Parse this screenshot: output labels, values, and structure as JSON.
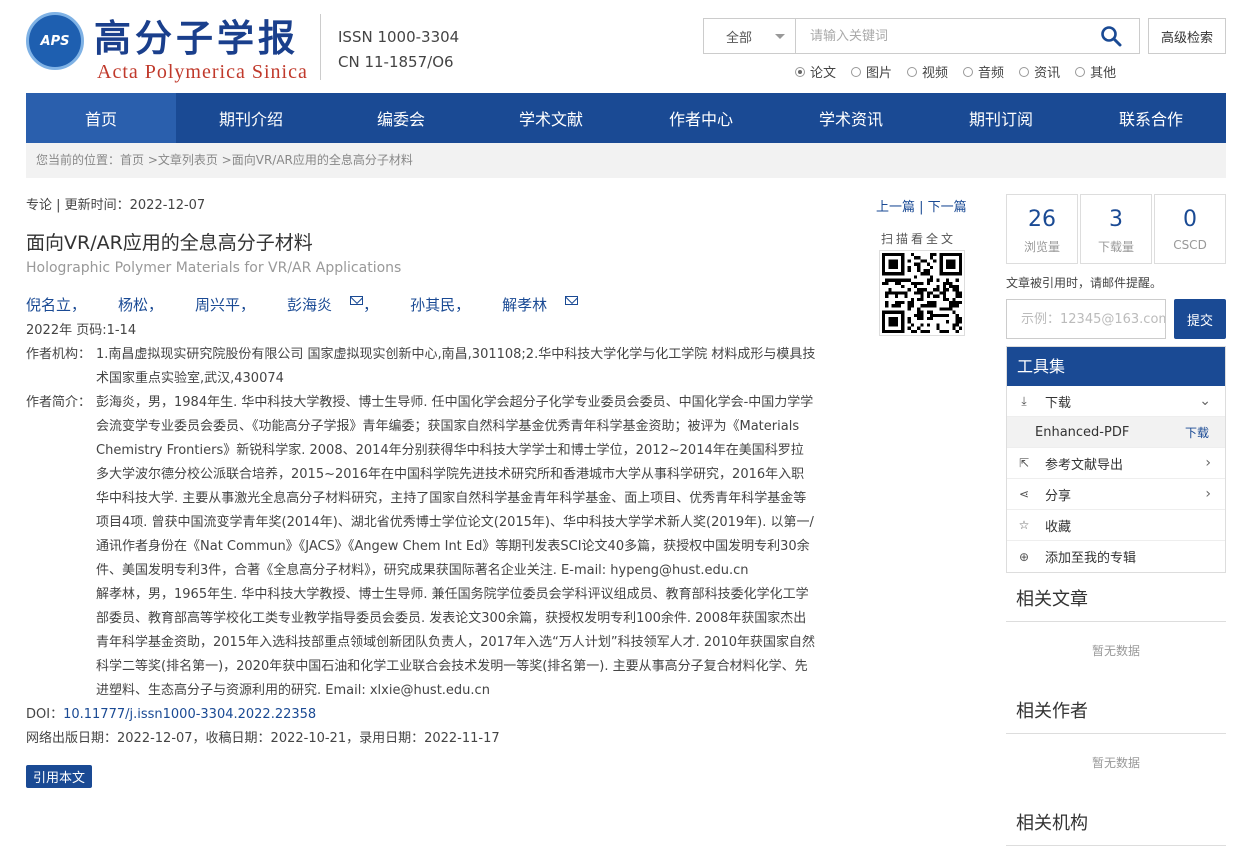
{
  "header": {
    "logo_text": "APS",
    "title_cn": "高分子学报",
    "title_en": "Acta Polymerica Sinica",
    "issn": "ISSN  1000-3304",
    "cn": "CN  11-1857/O6",
    "search_scope": "全部",
    "search_placeholder": "请输入关键词",
    "advanced_search": "高级检索",
    "search_types": [
      "论文",
      "图片",
      "视频",
      "音频",
      "资讯",
      "其他"
    ]
  },
  "nav": [
    "首页",
    "期刊介绍",
    "编委会",
    "学术文献",
    "作者中心",
    "学术资讯",
    "期刊订阅",
    "联系合作"
  ],
  "breadcrumb": "您当前的位置：首页 >文章列表页 >面向VR/AR应用的全息高分子材料",
  "article": {
    "meta": "专论 | 更新时间：2022-12-07",
    "title": "面向VR/AR应用的全息高分子材料",
    "title_en": "Holographic Polymer Materials for VR/AR Applications",
    "authors": [
      "倪名立，",
      "杨松，",
      "周兴平，",
      "彭海炎",
      "，",
      "孙其民，",
      "解孝林"
    ],
    "year_pages": "2022年 页码:1-14",
    "affiliation_label": "作者机构：",
    "affiliation": "1.南昌虚拟现实研究院股份有限公司 国家虚拟现实创新中心,南昌,301108;2.华中科技大学化学与化工学院 材料成形与模具技术国家重点实验室,武汉,430074",
    "bio_label": "作者简介：",
    "bio1": "彭海炎，男，1984年生. 华中科技大学教授、博士生导师. 任中国化学会超分子化学专业委员会委员、中国化学会-中国力学学会流变学专业委员会委员、《功能高分子学报》青年编委；获国家自然科学基金优秀青年科学基金资助；被评为《Materials Chemistry Frontiers》新锐科学家. 2008、2014年分别获得华中科技大学学士和博士学位，2012~2014年在美国科罗拉多大学波尔德分校公派联合培养，2015~2016年在中国科学院先进技术研究所和香港城市大学从事科学研究，2016年入职华中科技大学. 主要从事激光全息高分子材料研究，主持了国家自然科学基金青年科学基金、面上项目、优秀青年科学基金等项目4项. 曾获中国流变学青年奖(2014年)、湖北省优秀博士学位论文(2015年)、华中科技大学学术新人奖(2019年). 以第一/通讯作者身份在《Nat Commun》《JACS》《Angew Chem Int Ed》等期刊发表SCI论文40多篇，获授权中国发明专利30余件、美国发明专利3件，合著《全息高分子材料》，研究成果获国际著名企业关注. E-mail: hypeng@hust.edu.cn",
    "bio2": "解孝林，男，1965年生. 华中科技大学教授、博士生导师. 兼任国务院学位委员会学科评议组成员、教育部科技委化学化工学部委员、教育部高等学校化工类专业教学指导委员会委员. 发表论文300余篇，获授权发明专利100余件. 2008年获国家杰出青年科学基金资助，2015年入选科技部重点领域创新团队负责人，2017年入选“万人计划”科技领军人才. 2010年获国家自然科学二等奖(排名第一)，2020年获中国石油和化学工业联合会技术发明一等奖(排名第一). 主要从事高分子复合材料化学、先进塑料、生态高分子与资源利用的研究. Email: xlxie@hust.edu.cn",
    "doi_label": "DOI：",
    "doi": "10.11777/j.issn1000-3304.2022.22358",
    "dates": "网络出版日期：2022-12-07，收稿日期：2022-10-21，录用日期：2022-11-17",
    "cite_button": "引用本文",
    "prev": "上一篇",
    "next": "下一篇",
    "qr_label": "扫描看全文"
  },
  "sidebar": {
    "stats": [
      {
        "value": "26",
        "label": "浏览量"
      },
      {
        "value": "3",
        "label": "下载量"
      },
      {
        "value": "0",
        "label": "CSCD"
      }
    ],
    "cite_tip": "文章被引用时，请邮件提醒。",
    "email_placeholder": "示例：12345@163.com",
    "submit": "提交",
    "tools_title": "工具集",
    "download": "下载",
    "enhanced_pdf": "Enhanced-PDF",
    "enhanced_dl": "下载",
    "export": "参考文献导出",
    "share": "分享",
    "collect": "收藏",
    "add_special": "添加至我的专辑",
    "related_articles": "相关文章",
    "related_authors": "相关作者",
    "related_orgs": "相关机构",
    "no_data": "暂无数据"
  },
  "colors": {
    "primary": "#1a4a94",
    "nav_active": "#2a5fad",
    "logo_red": "#c0392b"
  }
}
